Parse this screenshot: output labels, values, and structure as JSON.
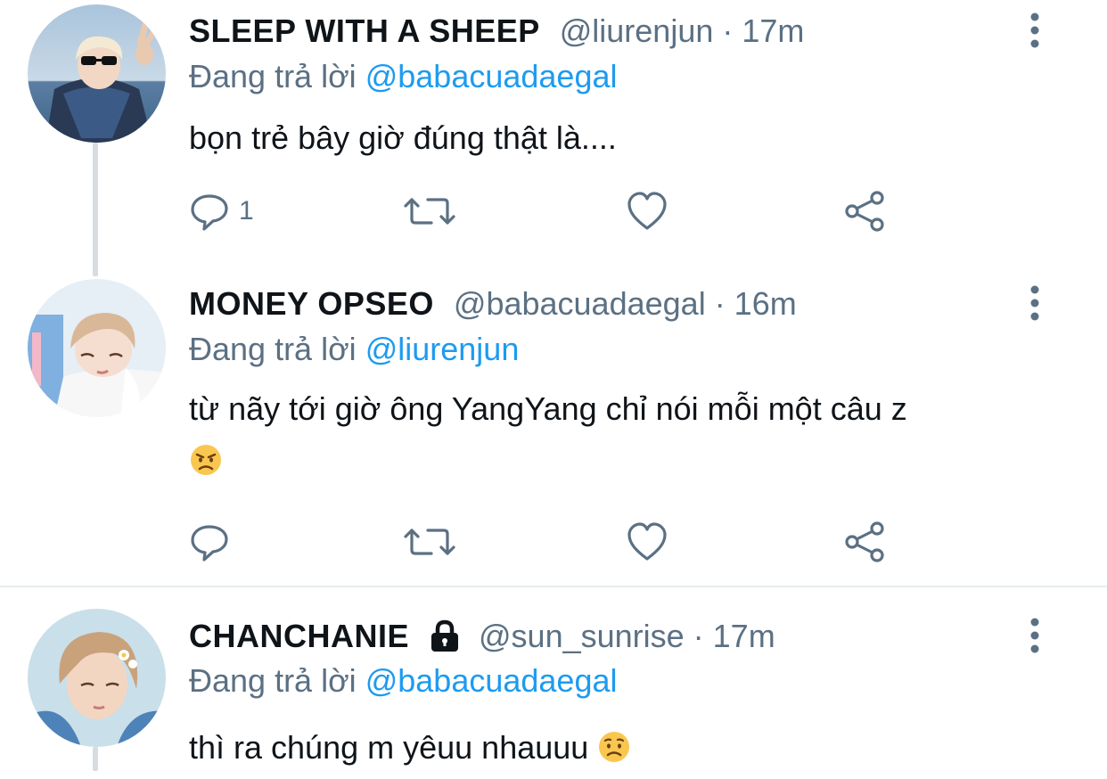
{
  "colors": {
    "link": "#1d9bf0",
    "secondary_text": "#5b7083",
    "primary_text": "#0f1419",
    "thread_line": "#d6dce0",
    "divider": "#e6ecf0"
  },
  "tweets": [
    {
      "display_name": "SLEEP WITH A SHEEP",
      "meta": "@liurenjun · 17m",
      "reply_prefix": "Đang trả lời",
      "reply_to": "@babacuadaegal",
      "text": "bọn trẻ bây giờ đúng thật là....",
      "reply_count": "1",
      "icons": [
        "reply-icon",
        "retweet-icon",
        "like-icon",
        "share-icon",
        "more-icon"
      ]
    },
    {
      "display_name": "MONEY OPSEO",
      "meta": "@babacuadaegal · 16m",
      "reply_prefix": "Đang trả lời",
      "reply_to": "@liurenjun",
      "text": "từ nãy tới giờ ông YangYang chỉ nói mỗi một câu z",
      "emoji": "angry-face-emoji",
      "reply_count": "",
      "icons": [
        "reply-icon",
        "retweet-icon",
        "like-icon",
        "share-icon",
        "more-icon"
      ]
    },
    {
      "display_name": "CHANCHANIE",
      "locked": true,
      "meta": "@sun_sunrise · 17m",
      "reply_prefix": "Đang trả lời",
      "reply_to": "@babacuadaegal",
      "text": "thì ra chúng m yêuu nhauuu",
      "emoji": "worried-face-emoji",
      "icons": [
        "lock-icon",
        "more-icon"
      ]
    }
  ]
}
